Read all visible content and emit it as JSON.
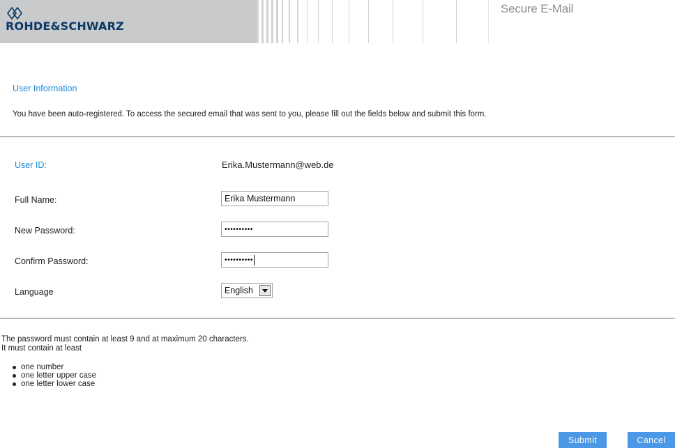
{
  "header": {
    "brand": "ROHDE&SCHWARZ",
    "logo_icon": "rohde-schwarz-diamond-logo",
    "product_title": "Secure E-Mail"
  },
  "section_title": "User Information",
  "intro": "You have been auto-registered. To access the secured email that was sent to you, please fill out the fields below and submit this form.",
  "form": {
    "user_id_label": "User ID:",
    "user_id_value": "Erika.Mustermann@web.de",
    "full_name_label": "Full Name:",
    "full_name_value": "Erika Mustermann",
    "new_password_label": "New Password:",
    "new_password_mask": "••••••••••",
    "confirm_password_label": "Confirm Password:",
    "confirm_password_mask": "••••••••••",
    "language_label": "Language",
    "language_value": "English"
  },
  "password_rules": {
    "line1": "The password must contain at least 9 and at maximum 20 characters.",
    "line2": "It must contain at least",
    "items": [
      "one number",
      "one letter upper case",
      "one letter lower case"
    ]
  },
  "buttons": {
    "submit": "Submit",
    "cancel": "Cancel"
  },
  "colors": {
    "accent_blue": "#1c8ad6",
    "button_blue": "#4a98e6",
    "brand_navy": "#0b3a66"
  }
}
